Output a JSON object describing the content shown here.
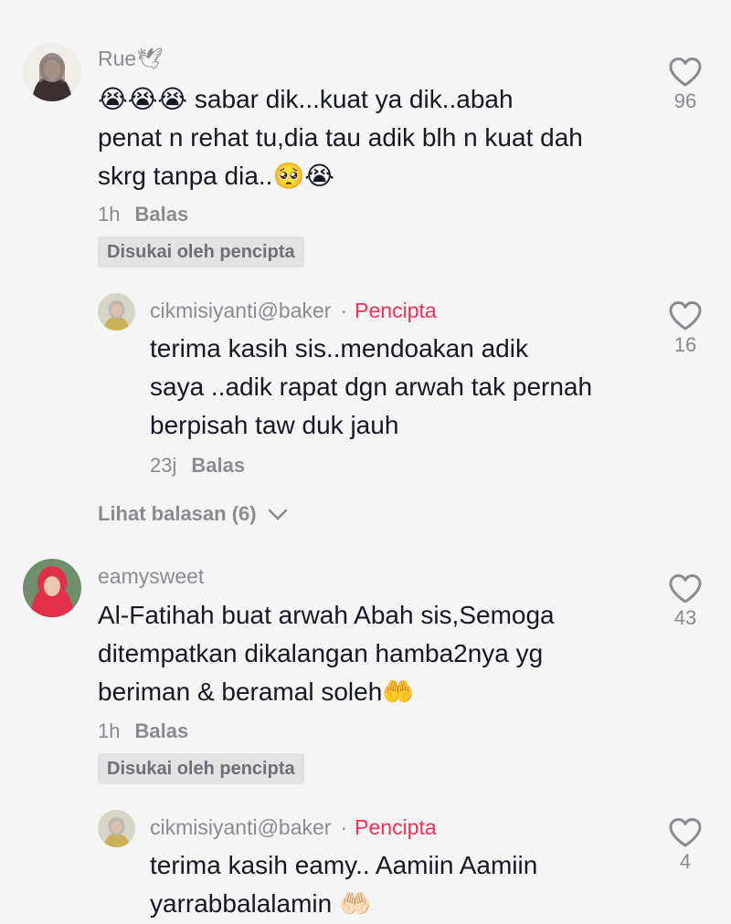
{
  "comments": [
    {
      "username": "Rue🕊",
      "text_lines": [
        "😭😭😭 sabar dik...kuat ya dik..abah",
        "penat n rehat tu,dia tau adik blh n kuat dah",
        "skrg tanpa dia..🥺😭"
      ],
      "time": "1h",
      "reply_label": "Balas",
      "liked_badge": "Disukai oleh pencipta",
      "likes": "96",
      "reply": {
        "username": "cikmisiyanti@baker",
        "separator": "·",
        "creator_label": "Pencipta",
        "text_lines": [
          "terima kasih sis..mendoakan adik",
          "saya ..adik rapat dgn arwah tak pernah",
          "berpisah taw duk jauh"
        ],
        "time": "23j",
        "reply_label": "Balas",
        "likes": "16"
      },
      "view_replies": "Lihat balasan (6)"
    },
    {
      "username": "eamysweet",
      "text_lines": [
        "Al-Fatihah buat arwah Abah sis,Semoga",
        "ditempatkan dikalangan hamba2nya yg",
        "beriman & beramal soleh🤲"
      ],
      "time": "1h",
      "reply_label": "Balas",
      "liked_badge": "Disukai oleh pencipta",
      "likes": "43",
      "reply": {
        "username": "cikmisiyanti@baker",
        "separator": "·",
        "creator_label": "Pencipta",
        "text_lines": [
          "terima kasih eamy.. Aamiin Aamiin",
          "yarrabbalalamin 🤲🏻"
        ],
        "likes": "4"
      }
    }
  ],
  "colors": {
    "background": "#f5f5f6",
    "text": "#161823",
    "muted": "#8a8b91",
    "creator": "#fe2c55",
    "badge_bg": "#e3e3e4"
  }
}
